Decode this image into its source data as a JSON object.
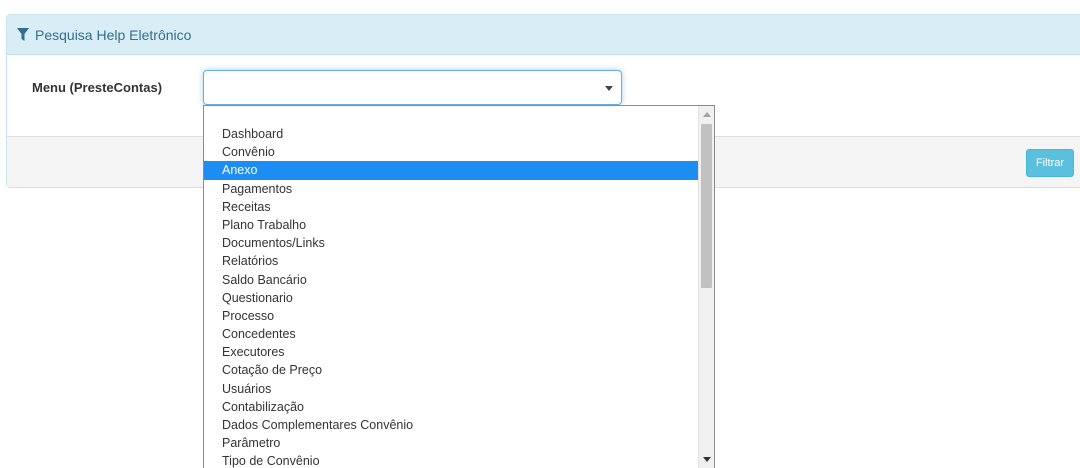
{
  "panel": {
    "title": "Pesquisa Help Eletrônico"
  },
  "form": {
    "menu_label": "Menu (PresteContas)",
    "menu_value": ""
  },
  "footer": {
    "filter_label": "Filtrar"
  },
  "dropdown": {
    "selected_index": 2,
    "options": [
      "Dashboard",
      "Convênio",
      "Anexo",
      "Pagamentos",
      "Receitas",
      "Plano Trabalho",
      "Documentos/Links",
      "Relatórios",
      "Saldo Bancário",
      "Questionario",
      "Processo",
      "Concedentes",
      "Executores",
      "Cotação de Preço",
      "Usuários",
      "Contabilização",
      "Dados Complementares Convênio",
      "Parâmetro",
      "Tipo de Convênio"
    ]
  },
  "colors": {
    "heading_bg": "#d9edf7",
    "heading_text": "#31708f",
    "selected_option_bg": "#1c8df3",
    "button_bg": "#5bc0de"
  }
}
